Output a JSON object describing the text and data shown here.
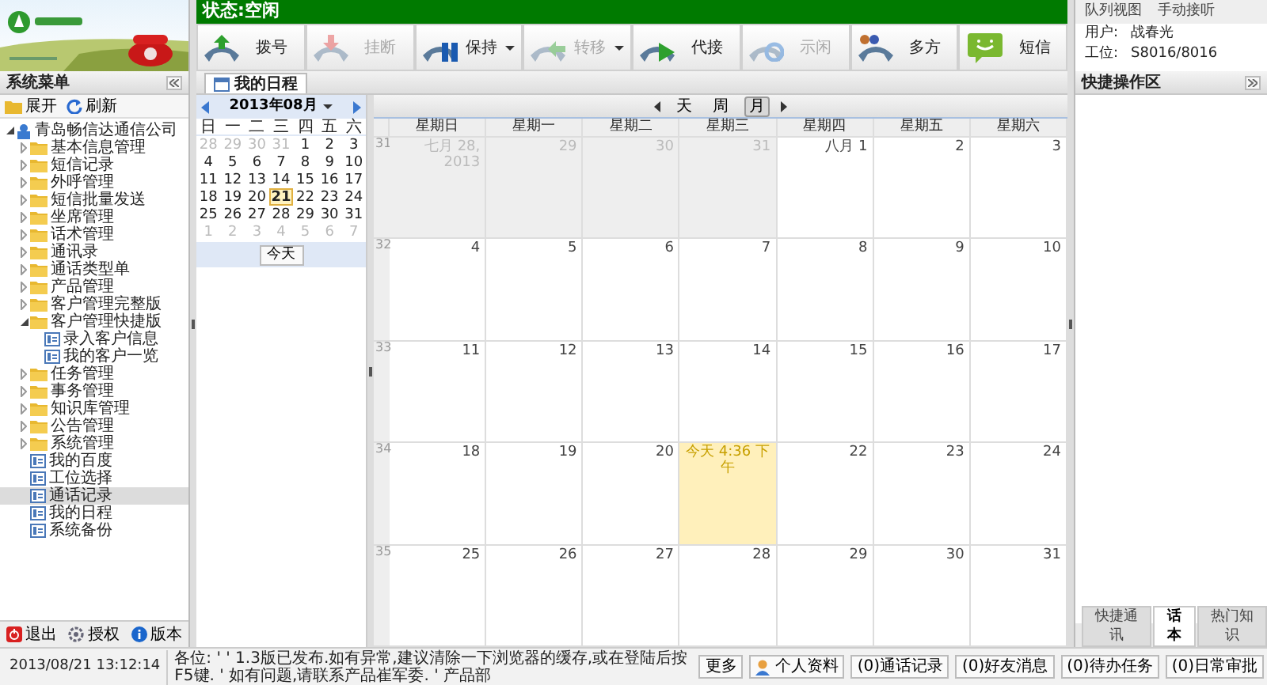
{
  "status": "状态:空闲",
  "toolbar": [
    {
      "label": "拨号",
      "kind": "dial",
      "disabled": false,
      "dropdown": false
    },
    {
      "label": "挂断",
      "kind": "hangup",
      "disabled": true,
      "dropdown": false
    },
    {
      "label": "保持",
      "kind": "hold",
      "disabled": false,
      "dropdown": true
    },
    {
      "label": "转移",
      "kind": "transfer",
      "disabled": true,
      "dropdown": true
    },
    {
      "label": "代接",
      "kind": "pickup",
      "disabled": false,
      "dropdown": false
    },
    {
      "label": "示闲",
      "kind": "idle",
      "disabled": true,
      "dropdown": false
    },
    {
      "label": "多方",
      "kind": "conference",
      "disabled": false,
      "dropdown": false
    },
    {
      "label": "短信",
      "kind": "sms",
      "disabled": false,
      "dropdown": false
    }
  ],
  "top_links": [
    "队列视图",
    "手动接听"
  ],
  "user": [
    {
      "label": "用户:",
      "value": "战春光"
    },
    {
      "label": "工位:",
      "value": "S8016/8016"
    }
  ],
  "sidebar": {
    "title": "系统菜单",
    "actions": [
      {
        "label": "展开",
        "kind": "expand"
      },
      {
        "label": "刷新",
        "kind": "refresh"
      }
    ],
    "tree": [
      {
        "label": "青岛畅信达通信公司",
        "kind": "org",
        "expanded": true,
        "selected": false,
        "children": [
          {
            "label": "基本信息管理",
            "kind": "folder",
            "expanded": false,
            "selected": false
          },
          {
            "label": "短信记录",
            "kind": "folder",
            "expanded": false,
            "selected": false
          },
          {
            "label": "外呼管理",
            "kind": "folder",
            "expanded": false,
            "selected": false
          },
          {
            "label": "短信批量发送",
            "kind": "folder",
            "expanded": false,
            "selected": false
          },
          {
            "label": "坐席管理",
            "kind": "folder",
            "expanded": false,
            "selected": false
          },
          {
            "label": "话术管理",
            "kind": "folder",
            "expanded": false,
            "selected": false
          },
          {
            "label": "通讯录",
            "kind": "folder",
            "expanded": false,
            "selected": false
          },
          {
            "label": "通话类型单",
            "kind": "folder",
            "expanded": false,
            "selected": false
          },
          {
            "label": "产品管理",
            "kind": "folder",
            "expanded": false,
            "selected": false
          },
          {
            "label": "客户管理完整版",
            "kind": "folder",
            "expanded": false,
            "selected": false
          },
          {
            "label": "客户管理快捷版",
            "kind": "folder",
            "expanded": true,
            "selected": false,
            "children": [
              {
                "label": "录入客户信息",
                "kind": "page",
                "selected": false
              },
              {
                "label": "我的客户一览",
                "kind": "page",
                "selected": false
              }
            ]
          },
          {
            "label": "任务管理",
            "kind": "folder",
            "expanded": false,
            "selected": false
          },
          {
            "label": "事务管理",
            "kind": "folder",
            "expanded": false,
            "selected": false
          },
          {
            "label": "知识库管理",
            "kind": "folder",
            "expanded": false,
            "selected": false
          },
          {
            "label": "公告管理",
            "kind": "folder",
            "expanded": false,
            "selected": false
          },
          {
            "label": "系统管理",
            "kind": "folder",
            "expanded": false,
            "selected": false
          },
          {
            "label": "我的百度",
            "kind": "page",
            "selected": false
          },
          {
            "label": "工位选择",
            "kind": "page",
            "selected": false
          },
          {
            "label": "通话记录",
            "kind": "page",
            "selected": true
          },
          {
            "label": "我的日程",
            "kind": "page",
            "selected": false
          },
          {
            "label": "系统备份",
            "kind": "page",
            "selected": false
          }
        ]
      }
    ],
    "footer": [
      {
        "label": "退出",
        "kind": "exit"
      },
      {
        "label": "授权",
        "kind": "license"
      },
      {
        "label": "版本",
        "kind": "info"
      }
    ]
  },
  "tabs": [
    {
      "label": "我的日程",
      "selected": true
    }
  ],
  "mini_calendar": {
    "month": "2013年08月",
    "weekdays": [
      "日",
      "一",
      "二",
      "三",
      "四",
      "五",
      "六"
    ],
    "weeks": [
      [
        {
          "day": "28",
          "other_month": true,
          "selected": false
        },
        {
          "day": "29",
          "other_month": true,
          "selected": false
        },
        {
          "day": "30",
          "other_month": true,
          "selected": false
        },
        {
          "day": "31",
          "other_month": true,
          "selected": false
        },
        {
          "day": "1",
          "other_month": false,
          "selected": false
        },
        {
          "day": "2",
          "other_month": false,
          "selected": false
        },
        {
          "day": "3",
          "other_month": false,
          "selected": false
        }
      ],
      [
        {
          "day": "4",
          "other_month": false,
          "selected": false
        },
        {
          "day": "5",
          "other_month": false,
          "selected": false
        },
        {
          "day": "6",
          "other_month": false,
          "selected": false
        },
        {
          "day": "7",
          "other_month": false,
          "selected": false
        },
        {
          "day": "8",
          "other_month": false,
          "selected": false
        },
        {
          "day": "9",
          "other_month": false,
          "selected": false
        },
        {
          "day": "10",
          "other_month": false,
          "selected": false
        }
      ],
      [
        {
          "day": "11",
          "other_month": false,
          "selected": false
        },
        {
          "day": "12",
          "other_month": false,
          "selected": false
        },
        {
          "day": "13",
          "other_month": false,
          "selected": false
        },
        {
          "day": "14",
          "other_month": false,
          "selected": false
        },
        {
          "day": "15",
          "other_month": false,
          "selected": false
        },
        {
          "day": "16",
          "other_month": false,
          "selected": false
        },
        {
          "day": "17",
          "other_month": false,
          "selected": false
        }
      ],
      [
        {
          "day": "18",
          "other_month": false,
          "selected": false
        },
        {
          "day": "19",
          "other_month": false,
          "selected": false
        },
        {
          "day": "20",
          "other_month": false,
          "selected": false
        },
        {
          "day": "21",
          "other_month": false,
          "selected": true
        },
        {
          "day": "22",
          "other_month": false,
          "selected": false
        },
        {
          "day": "23",
          "other_month": false,
          "selected": false
        },
        {
          "day": "24",
          "other_month": false,
          "selected": false
        }
      ],
      [
        {
          "day": "25",
          "other_month": false,
          "selected": false
        },
        {
          "day": "26",
          "other_month": false,
          "selected": false
        },
        {
          "day": "27",
          "other_month": false,
          "selected": false
        },
        {
          "day": "28",
          "other_month": false,
          "selected": false
        },
        {
          "day": "29",
          "other_month": false,
          "selected": false
        },
        {
          "day": "30",
          "other_month": false,
          "selected": false
        },
        {
          "day": "31",
          "other_month": false,
          "selected": false
        }
      ],
      [
        {
          "day": "1",
          "other_month": true,
          "selected": false
        },
        {
          "day": "2",
          "other_month": true,
          "selected": false
        },
        {
          "day": "3",
          "other_month": true,
          "selected": false
        },
        {
          "day": "4",
          "other_month": true,
          "selected": false
        },
        {
          "day": "5",
          "other_month": true,
          "selected": false
        },
        {
          "day": "6",
          "other_month": true,
          "selected": false
        },
        {
          "day": "7",
          "other_month": true,
          "selected": false
        }
      ]
    ],
    "today_button": "今天"
  },
  "calendar": {
    "views": [
      {
        "label": "天",
        "selected": false
      },
      {
        "label": "周",
        "selected": false
      },
      {
        "label": "月",
        "selected": true
      }
    ],
    "weekdays": [
      "星期日",
      "星期一",
      "星期二",
      "星期三",
      "星期四",
      "星期五",
      "星期六"
    ],
    "weeks": [
      {
        "number": "31",
        "days": [
          {
            "label": "七月 28, 2013",
            "other_month": true,
            "today": false
          },
          {
            "label": "29",
            "other_month": true,
            "today": false
          },
          {
            "label": "30",
            "other_month": true,
            "today": false
          },
          {
            "label": "31",
            "other_month": true,
            "today": false
          },
          {
            "label": "八月 1",
            "other_month": false,
            "today": false
          },
          {
            "label": "2",
            "other_month": false,
            "today": false
          },
          {
            "label": "3",
            "other_month": false,
            "today": false
          }
        ]
      },
      {
        "number": "32",
        "days": [
          {
            "label": "4",
            "other_month": false,
            "today": false
          },
          {
            "label": "5",
            "other_month": false,
            "today": false
          },
          {
            "label": "6",
            "other_month": false,
            "today": false
          },
          {
            "label": "7",
            "other_month": false,
            "today": false
          },
          {
            "label": "8",
            "other_month": false,
            "today": false
          },
          {
            "label": "9",
            "other_month": false,
            "today": false
          },
          {
            "label": "10",
            "other_month": false,
            "today": false
          }
        ]
      },
      {
        "number": "33",
        "days": [
          {
            "label": "11",
            "other_month": false,
            "today": false
          },
          {
            "label": "12",
            "other_month": false,
            "today": false
          },
          {
            "label": "13",
            "other_month": false,
            "today": false
          },
          {
            "label": "14",
            "other_month": false,
            "today": false
          },
          {
            "label": "15",
            "other_month": false,
            "today": false
          },
          {
            "label": "16",
            "other_month": false,
            "today": false
          },
          {
            "label": "17",
            "other_month": false,
            "today": false
          }
        ]
      },
      {
        "number": "34",
        "days": [
          {
            "label": "18",
            "other_month": false,
            "today": false
          },
          {
            "label": "19",
            "other_month": false,
            "today": false
          },
          {
            "label": "20",
            "other_month": false,
            "today": false
          },
          {
            "label": "今天 4:36 下午",
            "other_month": false,
            "today": true
          },
          {
            "label": "22",
            "other_month": false,
            "today": false
          },
          {
            "label": "23",
            "other_month": false,
            "today": false
          },
          {
            "label": "24",
            "other_month": false,
            "today": false
          }
        ]
      },
      {
        "number": "35",
        "days": [
          {
            "label": "25",
            "other_month": false,
            "today": false
          },
          {
            "label": "26",
            "other_month": false,
            "today": false
          },
          {
            "label": "27",
            "other_month": false,
            "today": false
          },
          {
            "label": "28",
            "other_month": false,
            "today": false
          },
          {
            "label": "29",
            "other_month": false,
            "today": false
          },
          {
            "label": "30",
            "other_month": false,
            "today": false
          },
          {
            "label": "31",
            "other_month": false,
            "today": false
          }
        ]
      }
    ]
  },
  "quick_panel": {
    "title": "快捷操作区",
    "tabs": [
      {
        "label": "快捷通讯",
        "selected": false
      },
      {
        "label": "话本",
        "selected": true
      },
      {
        "label": "热门知识",
        "selected": false
      }
    ]
  },
  "status_bar": {
    "datetime": "2013/08/21 13:12:14",
    "notice": "各位: ' ' 1.3版已发布.如有异常,建议清除一下浏览器的缓存,或在登陆后按F5键. ' 如有问题,请联系产品崔军委. ' 产品部",
    "more": "更多",
    "buttons": [
      {
        "label": "个人资料",
        "kind": "profile"
      },
      {
        "label": "(0)通话记录",
        "kind": "plain"
      },
      {
        "label": "(0)好友消息",
        "kind": "plain"
      },
      {
        "label": "(0)待办任务",
        "kind": "plain"
      },
      {
        "label": "(0)日常审批",
        "kind": "plain"
      }
    ]
  }
}
